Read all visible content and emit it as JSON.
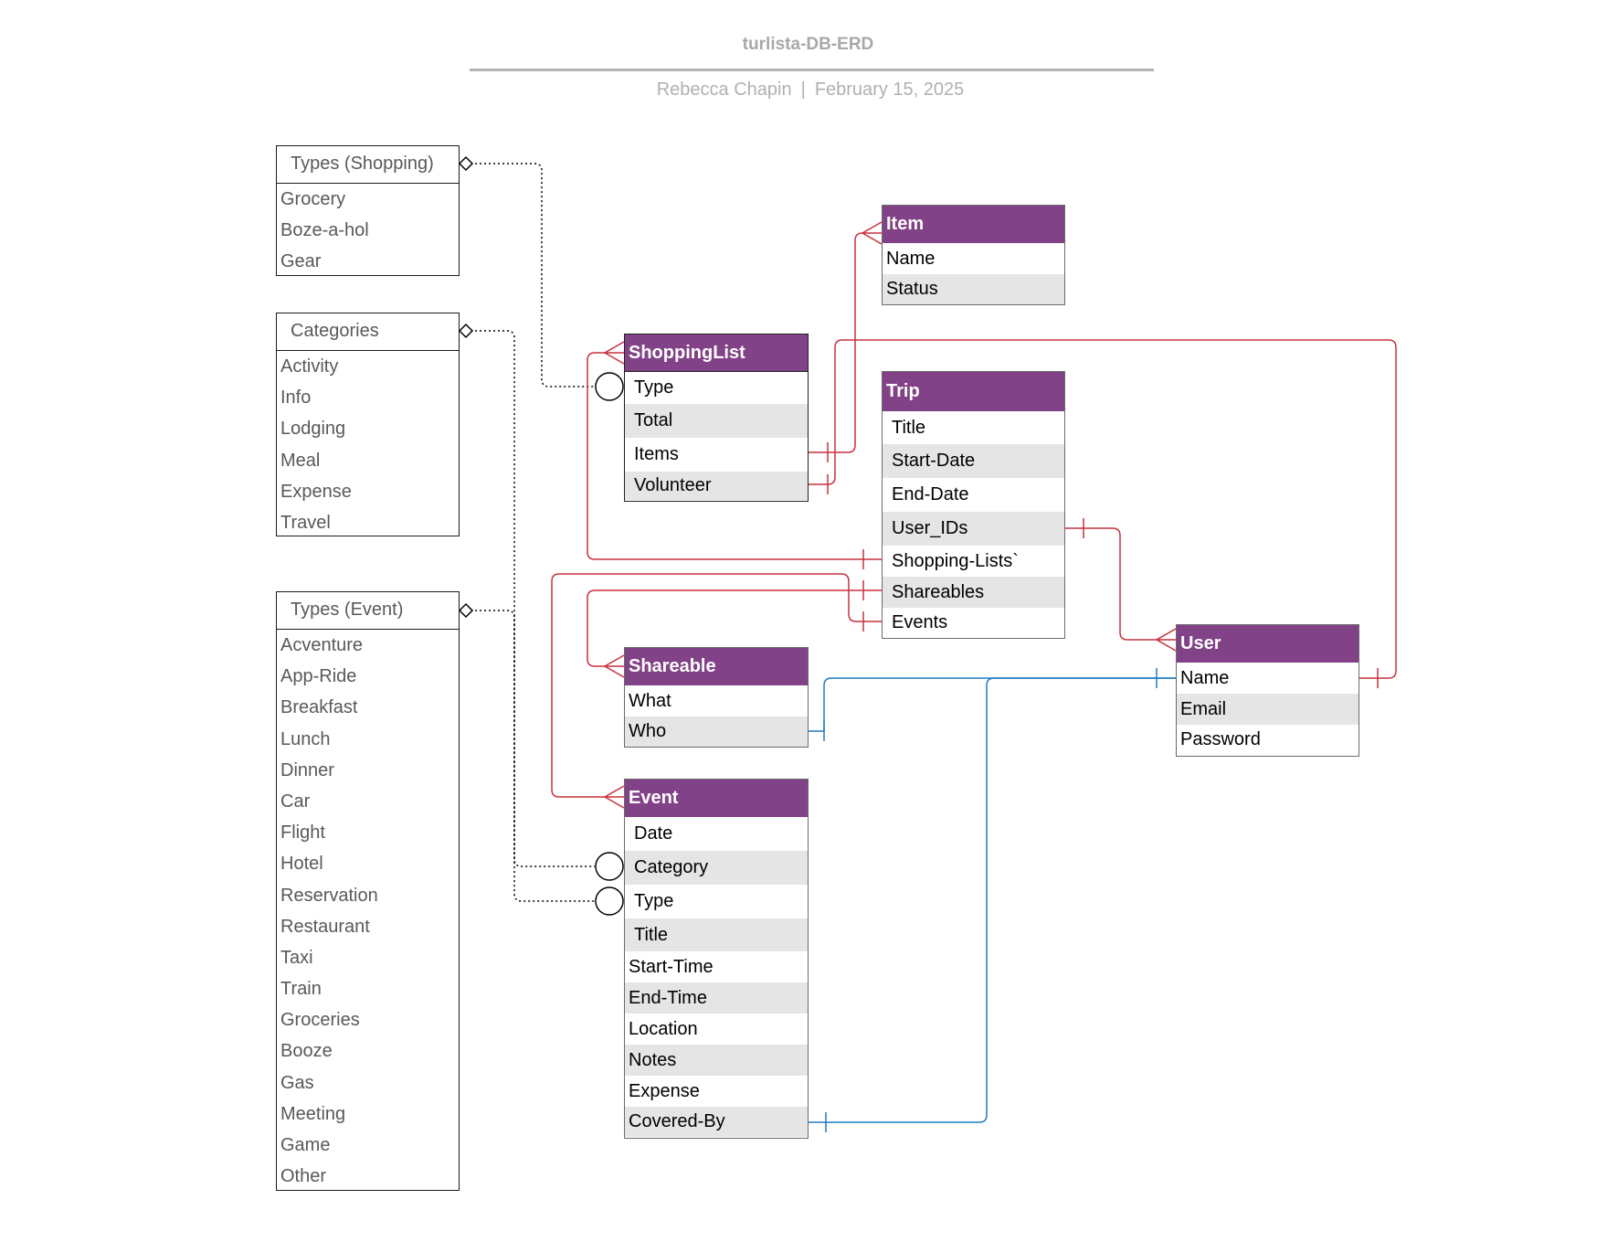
{
  "header": {
    "title": "turlista-DB-ERD",
    "author": "Rebecca Chapin",
    "separator": "|",
    "date": "February 15, 2025"
  },
  "enums": {
    "types_shopping": {
      "title": "Types (Shopping)",
      "values": [
        "Grocery",
        "Boze-a-hol",
        "Gear"
      ]
    },
    "categories": {
      "title": "Categories",
      "values": [
        "Activity",
        "Info",
        "Lodging",
        "Meal",
        "Expense",
        "Travel"
      ]
    },
    "types_event": {
      "title": "Types (Event)",
      "values": [
        "Acventure",
        "App-Ride",
        "Breakfast",
        "Lunch",
        "Dinner",
        "Car",
        "Flight",
        "Hotel",
        "Reservation",
        "Restaurant",
        "Taxi",
        "Train",
        "Groceries",
        "Booze",
        "Gas",
        "Meeting",
        "Game",
        "Other"
      ]
    }
  },
  "entities": {
    "shopping_list": {
      "title": "ShoppingList",
      "fields": [
        "Type",
        "Total",
        "Items",
        "Volunteer"
      ]
    },
    "item": {
      "title": "Item",
      "fields": [
        "Name",
        "Status"
      ]
    },
    "trip": {
      "title": "Trip",
      "fields": [
        "Title",
        "Start-Date",
        "End-Date",
        "User_IDs",
        "Shopping-Lists`",
        "Shareables",
        "Events"
      ]
    },
    "user": {
      "title": "User",
      "fields": [
        "Name",
        "Email",
        "Password"
      ]
    },
    "shareable": {
      "title": "Shareable",
      "fields": [
        "What",
        "Who"
      ]
    },
    "event": {
      "title": "Event",
      "fields": [
        "Date",
        "Category",
        "Type",
        "Title",
        "Start-Time",
        "End-Time",
        "Location",
        "Notes",
        "Expense",
        "Covered-By"
      ]
    }
  },
  "relationships": [
    {
      "from": "ShoppingList.Items",
      "to": "Item",
      "cardinality": "one-to-many",
      "color": "#c8313f"
    },
    {
      "from": "ShoppingList.Volunteer",
      "to": "User.Name",
      "cardinality": "one-to-one",
      "color": "#c8313f"
    },
    {
      "from": "Trip.User_IDs",
      "to": "User",
      "cardinality": "one-to-many",
      "color": "#c8313f"
    },
    {
      "from": "Trip.Shopping-Lists`",
      "to": "ShoppingList",
      "cardinality": "one-to-many",
      "color": "#c8313f"
    },
    {
      "from": "Trip.Shareables",
      "to": "Shareable",
      "cardinality": "one-to-many",
      "color": "#c8313f"
    },
    {
      "from": "Trip.Events",
      "to": "Event",
      "cardinality": "one-to-many",
      "color": "#c8313f"
    },
    {
      "from": "Shareable.Who",
      "to": "User.Name",
      "cardinality": "one-to-one",
      "color": "#1f7cc0"
    },
    {
      "from": "Event.Covered-By",
      "to": "User.Name",
      "cardinality": "one-to-one",
      "color": "#1f7cc0"
    },
    {
      "from": "Types (Shopping)",
      "to": "ShoppingList.Type",
      "cardinality": "enum",
      "color": "#000000"
    },
    {
      "from": "Categories",
      "to": "Event.Category",
      "cardinality": "enum",
      "color": "#000000"
    },
    {
      "from": "Types (Event)",
      "to": "Event.Type",
      "cardinality": "enum",
      "color": "#000000"
    }
  ],
  "colors": {
    "entity_header": "#824287",
    "relation_red": "#c8313f",
    "relation_blue": "#1f7cc0",
    "row_alt": "#e5e5e5"
  }
}
